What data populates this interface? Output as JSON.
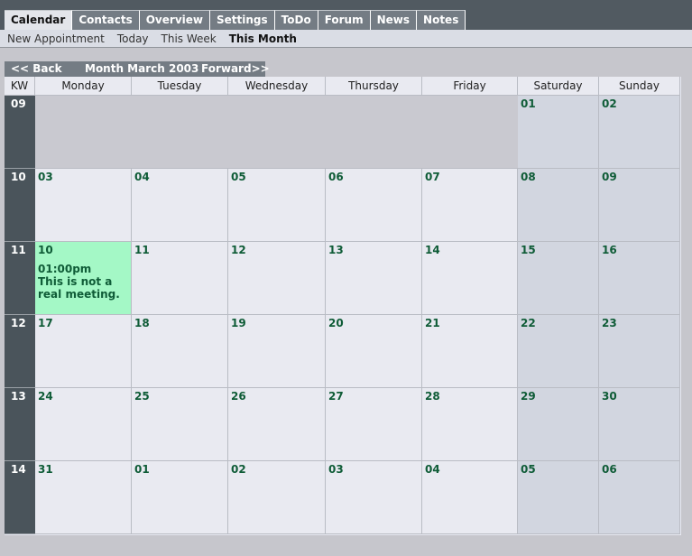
{
  "tabs": [
    "Calendar",
    "Contacts",
    "Overview",
    "Settings",
    "ToDo",
    "Forum",
    "News",
    "Notes"
  ],
  "active_tab": "Calendar",
  "subnav": [
    "New Appointment",
    "Today",
    "This Week",
    "This Month"
  ],
  "active_subnav": "This Month",
  "month_nav": {
    "back": "<< Back",
    "title": "Month March 2003",
    "forward": "Forward>>"
  },
  "calendar": {
    "kw_header": "KW",
    "days": [
      "Monday",
      "Tuesday",
      "Wednesday",
      "Thursday",
      "Friday",
      "Saturday",
      "Sunday"
    ],
    "weeks": [
      {
        "kw": "09",
        "dates": [
          "",
          "",
          "",
          "",
          "",
          "01",
          "02"
        ]
      },
      {
        "kw": "10",
        "dates": [
          "03",
          "04",
          "05",
          "06",
          "07",
          "08",
          "09"
        ]
      },
      {
        "kw": "11",
        "dates": [
          "10",
          "11",
          "12",
          "13",
          "14",
          "15",
          "16"
        ]
      },
      {
        "kw": "12",
        "dates": [
          "17",
          "18",
          "19",
          "20",
          "21",
          "22",
          "23"
        ]
      },
      {
        "kw": "13",
        "dates": [
          "24",
          "25",
          "26",
          "27",
          "28",
          "29",
          "30"
        ]
      },
      {
        "kw": "14",
        "dates": [
          "31",
          "01",
          "02",
          "03",
          "04",
          "05",
          "06"
        ]
      }
    ],
    "event": {
      "week": 2,
      "day": 0,
      "time": "01:00pm",
      "title": "This is not a real meeting."
    }
  },
  "colors": {
    "event_bg": "#a4f8c6",
    "date_text": "#0f5c37",
    "kw_bg": "#4a545b"
  }
}
